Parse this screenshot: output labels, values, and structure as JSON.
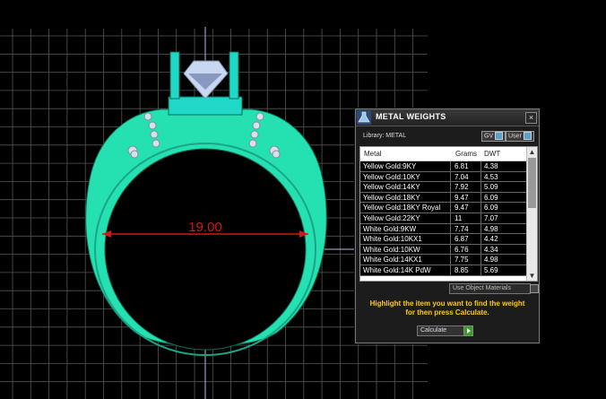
{
  "dimension": {
    "value": "19.00"
  },
  "panel": {
    "title": "METAL WEIGHTS",
    "close": "×",
    "library_label": "Library: METAL",
    "toggle_gv": "GV",
    "toggle_user": "User",
    "columns": [
      "Metal",
      "Grams",
      "DWT"
    ],
    "rows": [
      [
        "Yellow Gold:9KY",
        "6.81",
        "4.38"
      ],
      [
        "Yellow Gold:10KY",
        "7.04",
        "4.53"
      ],
      [
        "Yellow Gold:14KY",
        "7.92",
        "5.09"
      ],
      [
        "Yellow Gold:18KY",
        "9.47",
        "6.09"
      ],
      [
        "Yellow Gold:18KY Royal",
        "9.47",
        "6.09"
      ],
      [
        "Yellow Gold:22KY",
        "11",
        "7.07"
      ],
      [
        "White Gold:9KW",
        "7.74",
        "4.98"
      ],
      [
        "White Gold:10KX1",
        "6.87",
        "4.42"
      ],
      [
        "White Gold:10KW",
        "6.76",
        "4.34"
      ],
      [
        "White Gold:14KX1",
        "7.75",
        "4.98"
      ],
      [
        "White Gold:14K PdW",
        "8.85",
        "5.69"
      ]
    ],
    "use_object_label": "Use Object Materials",
    "hint_line1": "Highlight the item you want to find the weight",
    "hint_line2": "for then press Calculate.",
    "calculate_label": "Calculate"
  },
  "colors": {
    "ring": "#25e0b0",
    "ring_dark": "#1aa587",
    "dimension": "#d01818",
    "grid": "#555555",
    "hint": "#ffcc00"
  }
}
